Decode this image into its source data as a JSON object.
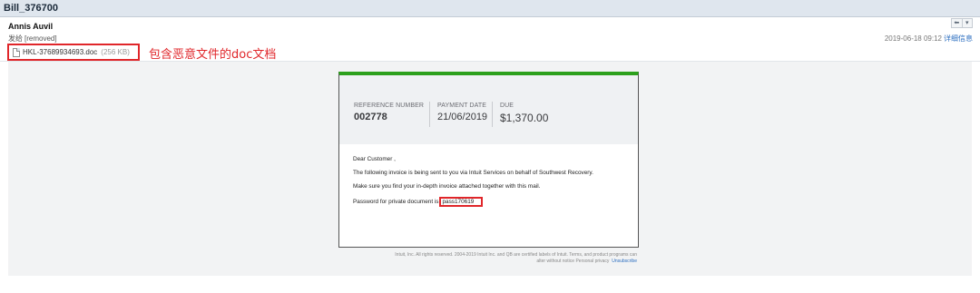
{
  "window": {
    "title": "Bill_376700"
  },
  "message": {
    "sender": "Annis Auvil",
    "to_label": "发给",
    "to_value": "[removed]",
    "date": "2019-06-18 09:12",
    "details_link": "详细信息",
    "reply_icon": "reply-arrow",
    "menu_icon": "dropdown-caret",
    "attachment": {
      "name": "HKL-37689934693.doc",
      "size": "(256 KB)",
      "icon": "doc-file-icon"
    },
    "annotation": "包含恶意文件的doc文档"
  },
  "email": {
    "accent_color": "#2ca01c",
    "reference_label": "REFERENCE NUMBER",
    "reference_value": "002778",
    "payment_date_label": "PAYMENT DATE",
    "payment_date_value": "21/06/2019",
    "due_label": "DUE",
    "due_value": "$1,370.00",
    "greeting": "Dear Customer ,",
    "line1": "The following invoice is being sent to you via Intuit Services on behalf of Southwest Recovery.",
    "line2": "Make sure you find your in-depth invoice attached together with this mail.",
    "password_prefix": "Password for private document  is",
    "password_value": "pass170619",
    "footer_line1": "Intuit, Inc. All rights reserved. 2004-2019 Intuit Inc. and QB are certified labels of Intuit. Terms,  and product programs can",
    "footer_line2": "alter without notice  Personal privacy",
    "footer_unsubscribe": "Unsubscribe"
  }
}
